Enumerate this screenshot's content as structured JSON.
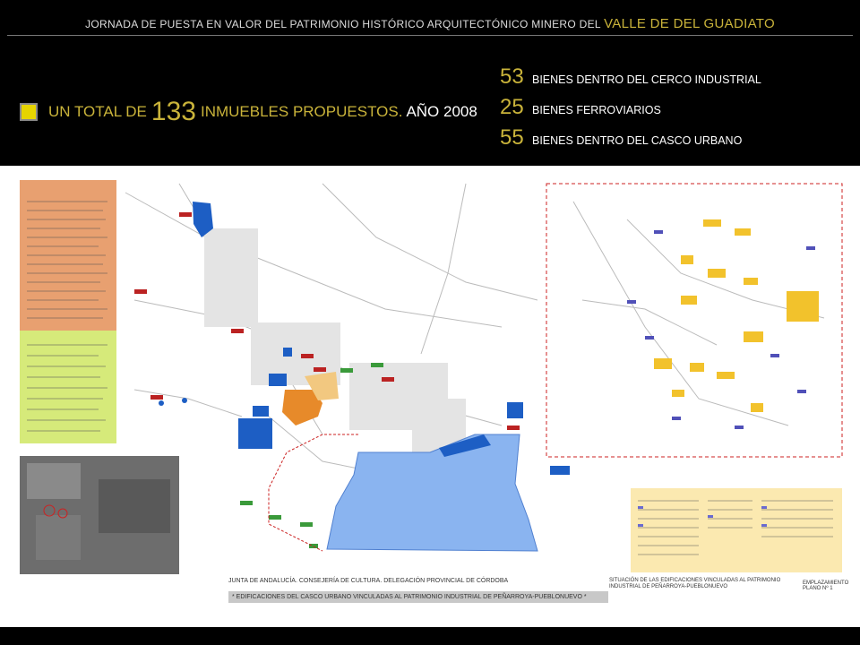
{
  "header": {
    "prefix": "JORNADA DE PUESTA EN VALOR DEL PATRIMONIO HISTÓRICO ARQUITECTÓNICO MINERO DEL",
    "highlight": "VALLE DE DEL GUADIATO"
  },
  "summary": {
    "pre": "UN TOTAL DE",
    "number": "133",
    "post": "INMUEBLES PROPUESTOS.",
    "year": "AÑO 2008"
  },
  "stats": [
    {
      "num": "53",
      "text": "BIENES DENTRO DEL CERCO INDUSTRIAL"
    },
    {
      "num": "25",
      "text": "BIENES  FERROVIARIOS"
    },
    {
      "num": "55",
      "text": "BIENES DENTRO DEL CASCO URBANO"
    }
  ],
  "plan": {
    "institution": "JUNTA DE ANDALUCÍA. CONSEJERÍA DE CULTURA. DELEGACIÓN PROVINCIAL DE CÓRDOBA",
    "note": "* EDIFICACIONES DEL CASCO URBANO VINCULADAS AL PATRIMONIO INDUSTRIAL DE PEÑARROYA-PUEBLONUEVO *",
    "situation": "SITUACIÓN DE LAS EDIFICACIONES VINCULADAS AL PATRIMONIO INDUSTRIAL DE PEÑARROYA-PUEBLONUEVO",
    "emplacement": "EMPLAZAMIENTO",
    "plan_number": "PLANO Nº 1"
  },
  "colors": {
    "accent": "#c9b33a",
    "blue": "#1d5ec4",
    "orange": "#e78a2a",
    "yellow": "#f2c22c",
    "lightblue": "#8ab4f0",
    "red": "#c22"
  }
}
